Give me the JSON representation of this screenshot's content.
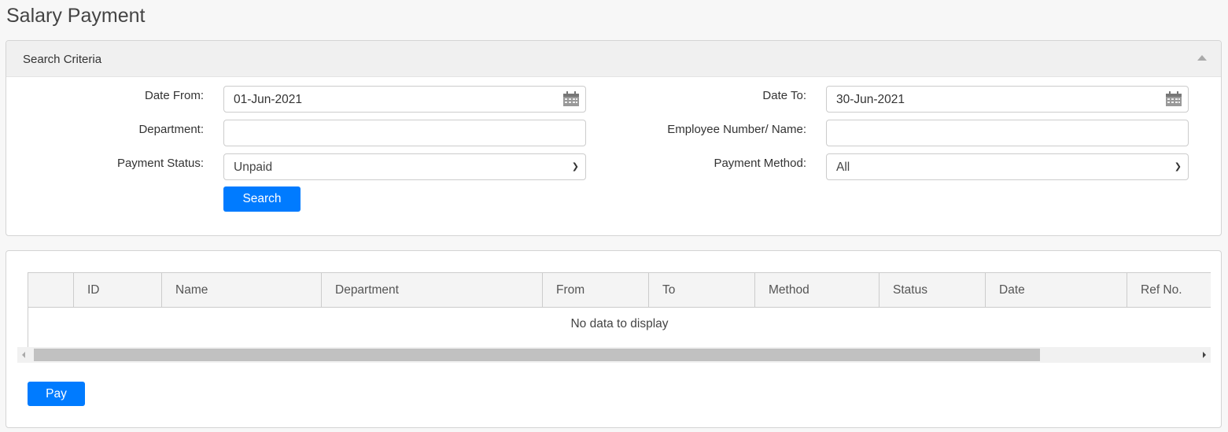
{
  "page": {
    "title": "Salary Payment"
  },
  "search": {
    "header": "Search Criteria",
    "date_from": {
      "label": "Date From:",
      "value": "01-Jun-2021"
    },
    "date_to": {
      "label": "Date To:",
      "value": "30-Jun-2021"
    },
    "department": {
      "label": "Department:",
      "value": ""
    },
    "employee": {
      "label": "Employee Number/ Name:",
      "value": ""
    },
    "payment_status": {
      "label": "Payment Status:",
      "value": "Unpaid"
    },
    "payment_method": {
      "label": "Payment Method:",
      "value": "All"
    },
    "search_button": "Search"
  },
  "grid": {
    "columns": [
      "",
      "ID",
      "Name",
      "Department",
      "From",
      "To",
      "Method",
      "Status",
      "Date",
      "Ref No."
    ],
    "empty_text": "No data to display"
  },
  "actions": {
    "pay_button": "Pay"
  },
  "colors": {
    "primary": "#007bff"
  }
}
